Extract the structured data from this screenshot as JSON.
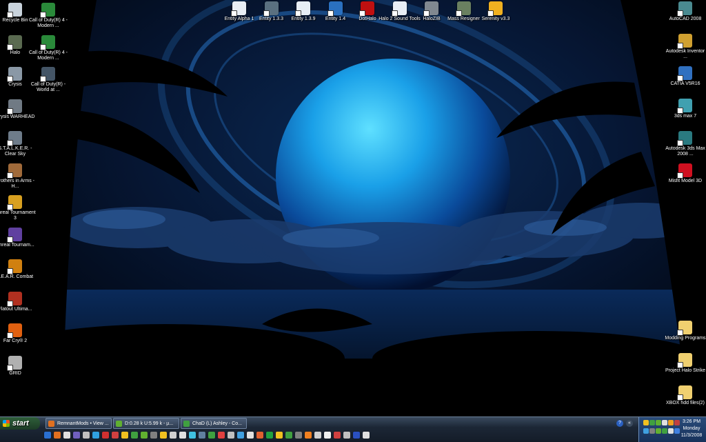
{
  "desktop": {
    "left_col1": [
      {
        "label": "Recycle Bin",
        "icon": "recycle-bin-icon",
        "color": "#c9d3dc"
      },
      {
        "label": "Halo",
        "icon": "halo-icon",
        "color": "#5a6a50"
      },
      {
        "label": "Crysis",
        "icon": "crysis-icon",
        "color": "#8a98a6"
      },
      {
        "label": "Crysis WARHEAD",
        "icon": "crysis-warhead-icon",
        "color": "#707a84"
      },
      {
        "label": "S.T.A.L.K.E.R. - Clear Sky",
        "icon": "stalker-icon",
        "color": "#6e7c8a"
      },
      {
        "label": "Brothers in Arms - H...",
        "icon": "brothers-in-arms-icon",
        "color": "#a06a3a"
      },
      {
        "label": "Unreal Tournament 3",
        "icon": "unreal-tournament-3-icon",
        "color": "#d8a020"
      },
      {
        "label": "Unreal Tournam...",
        "icon": "unreal-tournament-icon",
        "color": "#6040a0"
      },
      {
        "label": "F.E.A.R. Combat",
        "icon": "fear-combat-icon",
        "color": "#d08010"
      },
      {
        "label": "Flatout Ultima...",
        "icon": "flatout-icon",
        "color": "#b03020"
      },
      {
        "label": "Far Cry® 2",
        "icon": "far-cry-2-icon",
        "color": "#e06010"
      },
      {
        "label": "GRID",
        "icon": "grid-icon",
        "color": "#b0b0b0"
      }
    ],
    "left_col2": [
      {
        "label": "Call of Duty(R) 4 - Modern ...",
        "icon": "call-of-duty-4-icon",
        "color": "#2a8a3a"
      },
      {
        "label": "Call of Duty(R) 4 - Modern ...",
        "icon": "call-of-duty-4-mp-icon",
        "color": "#2a8a3a"
      },
      {
        "label": "Call of Duty(R) - World at ...",
        "icon": "call-of-duty-waw-icon",
        "color": "#445566"
      }
    ],
    "top_row": [
      {
        "label": "Entity Alpha 1",
        "icon": "entity-alpha-icon",
        "color": "#e8eef5"
      },
      {
        "label": "Entity 1.3.3",
        "icon": "entity-133-icon",
        "color": "#5a7080"
      },
      {
        "label": "Entity 1.3.9",
        "icon": "entity-139-icon",
        "color": "#e8eef5"
      },
      {
        "label": "Entity 1.4",
        "icon": "entity-14-icon",
        "color": "#2a70c0"
      },
      {
        "label": "DotHalo",
        "icon": "dothalo-icon",
        "color": "#c01010"
      },
      {
        "label": "Halo 2 Sound Tools",
        "icon": "halo-2-sound-tools-icon",
        "color": "#e8eef5"
      },
      {
        "label": "HaloZIB",
        "icon": "halozib-icon",
        "color": "#808890"
      },
      {
        "label": "Mass Resigner",
        "icon": "mass-resigner-icon",
        "color": "#6a8060"
      },
      {
        "label": "Serenity v3.3",
        "icon": "serenity-icon",
        "color": "#f0b020"
      }
    ],
    "right_col": [
      {
        "label": "AutoCAD 2008",
        "icon": "autocad-icon",
        "color": "#4a8a90"
      },
      {
        "label": "Autodesk Inventor ...",
        "icon": "autodesk-inventor-icon",
        "color": "#d0a030"
      },
      {
        "label": "CATIA V5R16",
        "icon": "catia-icon",
        "color": "#3070c0"
      },
      {
        "label": "3ds max 7",
        "icon": "3ds-max-7-icon",
        "color": "#40a0b0"
      },
      {
        "label": "Autodesk 3ds Max 2008 ...",
        "icon": "3ds-max-2008-icon",
        "color": "#2a7a80"
      },
      {
        "label": "Misfit Model 3D",
        "icon": "misfit-model-3d-icon",
        "color": "#d01020"
      }
    ],
    "right_folders": [
      {
        "label": "Modding Programs",
        "icon": "folder-icon",
        "color": "#f0d070"
      },
      {
        "label": "Project Halo Strike",
        "icon": "folder-icon",
        "color": "#f0d070"
      },
      {
        "label": "XBOX hdd files(2)",
        "icon": "folder-icon",
        "color": "#f0d070"
      }
    ]
  },
  "taskbar": {
    "start_label": "start",
    "tasks": [
      {
        "label": "RemnantMods • View ...",
        "icon": "firefox-icon",
        "color": "#e07020"
      },
      {
        "label": "D:0.28 k U:5.99 k - µ...",
        "icon": "utorrent-icon",
        "color": "#60b030"
      },
      {
        "label": "ChaD (L) Ashley - Co...",
        "icon": "msn-messenger-icon",
        "color": "#40a040"
      }
    ],
    "quick_launch_colors": [
      "#2a70d0",
      "#e07020",
      "#e0e0e0",
      "#7060c0",
      "#c0c0c0",
      "#30a0e0",
      "#d03030",
      "#d04040",
      "#f0c020",
      "#40a040",
      "#60b030",
      "#808080",
      "#f0c020",
      "#d0d0d0",
      "#e0e0e0",
      "#40c0e0",
      "#6080a0",
      "#40a040",
      "#e04040",
      "#c0c0c0",
      "#40a0e0",
      "#e0e0e0",
      "#e06030",
      "#20a040",
      "#f0c020",
      "#40a040",
      "#808080",
      "#f08020",
      "#d0d0d0",
      "#f0f0f0",
      "#d04040",
      "#c0c0c0",
      "#2a50c0",
      "#e0e0e0"
    ],
    "tray_colors": [
      "#f0c020",
      "#40a040",
      "#60b030",
      "#e0e0e0",
      "#f0a020",
      "#c04040",
      "#40a0e0",
      "#808080",
      "#60b030",
      "#40a040",
      "#e0e0e0",
      "#4080e0"
    ],
    "time": "3:26 PM",
    "day": "Monday",
    "date": "11/3/2008",
    "help_glyph": "?",
    "collapse_glyph": "«"
  }
}
